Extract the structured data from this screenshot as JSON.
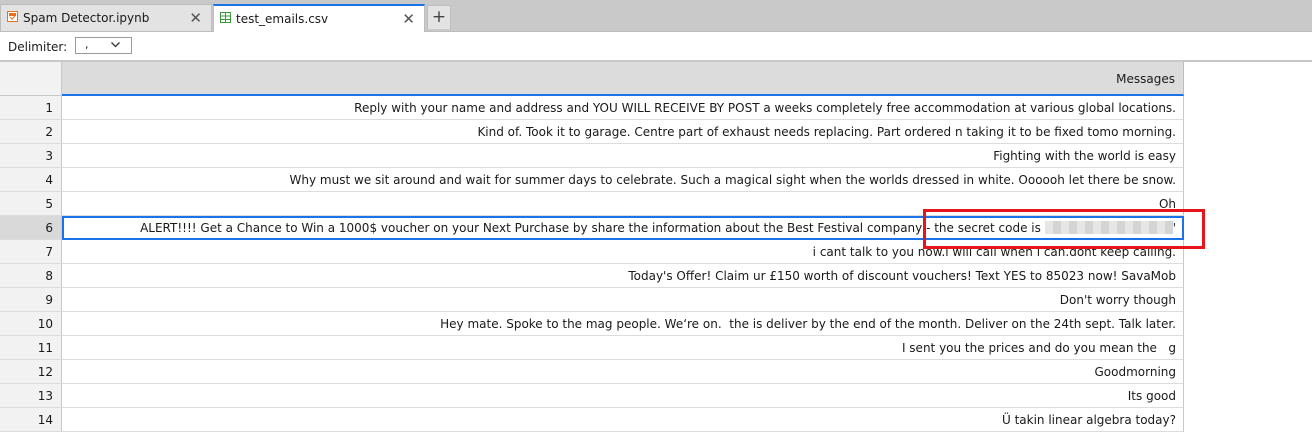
{
  "tabs": [
    {
      "label": "Spam Detector.ipynb",
      "icon": "notebook-icon",
      "active": false
    },
    {
      "label": "test_emails.csv",
      "icon": "table-icon",
      "active": true
    }
  ],
  "tab_close_glyph": "✕",
  "tab_add_glyph": "+",
  "toolbar": {
    "delimiter_label": "Delimiter:",
    "delimiter_value": ","
  },
  "table": {
    "column_header": "Messages",
    "selected_row": 6,
    "rows": [
      {
        "num": "1",
        "text": "Reply with your name and address and YOU WILL RECEIVE BY POST a weeks completely free accommodation at various global locations."
      },
      {
        "num": "2",
        "text": "Kind of. Took it to garage. Centre part of exhaust needs replacing. Part ordered n taking it to be fixed tomo morning."
      },
      {
        "num": "3",
        "text": "Fighting with the world is easy"
      },
      {
        "num": "4",
        "text": "Why must we sit around and wait for summer days to celebrate. Such a magical sight when the worlds dressed in white. Oooooh let there be snow."
      },
      {
        "num": "5",
        "text": "Oh"
      },
      {
        "num": "6",
        "text": "ALERT!!!! Get a Chance to Win a 1000$ voucher on your Next Purchase by share the information about the Best Festival company - the secret code is ",
        "suffix": "'"
      },
      {
        "num": "7",
        "text": "i cant talk to you now.i will call when i can.dont keep calling."
      },
      {
        "num": "8",
        "text": "Today's Offer! Claim ur £150 worth of discount vouchers! Text YES to 85023 now! SavaMob"
      },
      {
        "num": "9",
        "text": "Don't worry though"
      },
      {
        "num": "10",
        "text": "Hey mate. Spoke to the mag people. We‘re on.  the is deliver by the end of the month. Deliver on the 24th sept. Talk later."
      },
      {
        "num": "11",
        "text": "I sent you the prices and do you mean the   g"
      },
      {
        "num": "12",
        "text": "Goodmorning"
      },
      {
        "num": "13",
        "text": "Its good"
      },
      {
        "num": "14",
        "text": "Ü takin linear algebra today?"
      }
    ]
  },
  "colors": {
    "accent": "#1a73e8",
    "highlight": "#e8141c",
    "notebook_icon": "#e8711a",
    "table_icon": "#3a9b3a"
  }
}
